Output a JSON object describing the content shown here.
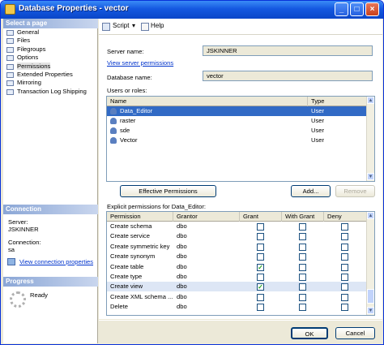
{
  "window": {
    "title": "Database Properties - vector"
  },
  "titlebar_buttons": {
    "minimize": "_",
    "maximize": "□",
    "close": "×"
  },
  "left": {
    "select_page_header": "Select a page",
    "pages": [
      {
        "label": "General"
      },
      {
        "label": "Files"
      },
      {
        "label": "Filegroups"
      },
      {
        "label": "Options"
      },
      {
        "label": "Permissions"
      },
      {
        "label": "Extended Properties"
      },
      {
        "label": "Mirroring"
      },
      {
        "label": "Transaction Log Shipping"
      }
    ],
    "connection_header": "Connection",
    "server_label": "Server:",
    "server_value": "JSKINNER",
    "connection_label": "Connection:",
    "connection_value": "sa",
    "view_connection_link": "View connection properties",
    "progress_header": "Progress",
    "progress_status": "Ready"
  },
  "toolbar": {
    "script_label": "Script",
    "help_label": "Help"
  },
  "form": {
    "server_name_label": "Server name:",
    "server_name_value": "JSKINNER",
    "view_server_permissions_link": "View server permissions",
    "database_name_label": "Database name:",
    "database_name_value": "vector",
    "users_roles_label": "Users or roles:"
  },
  "users_grid": {
    "columns": [
      "Name",
      "Type"
    ],
    "rows": [
      {
        "name": "Data_Editor",
        "type": "User"
      },
      {
        "name": "raster",
        "type": "User"
      },
      {
        "name": "sde",
        "type": "User"
      },
      {
        "name": "Vector",
        "type": "User"
      }
    ]
  },
  "buttons": {
    "effective_permissions": "Effective Permissions",
    "add": "Add...",
    "remove": "Remove",
    "ok": "OK",
    "cancel": "Cancel"
  },
  "permissions": {
    "label": "Explicit permissions for Data_Editor:",
    "columns": [
      "Permission",
      "Grantor",
      "Grant",
      "With Grant",
      "Deny"
    ],
    "rows": [
      {
        "permission": "Create schema",
        "grantor": "dbo",
        "grant": false,
        "with_grant": false,
        "deny": false
      },
      {
        "permission": "Create service",
        "grantor": "dbo",
        "grant": false,
        "with_grant": false,
        "deny": false
      },
      {
        "permission": "Create symmetric key",
        "grantor": "dbo",
        "grant": false,
        "with_grant": false,
        "deny": false
      },
      {
        "permission": "Create synonym",
        "grantor": "dbo",
        "grant": false,
        "with_grant": false,
        "deny": false
      },
      {
        "permission": "Create table",
        "grantor": "dbo",
        "grant": true,
        "with_grant": false,
        "deny": false
      },
      {
        "permission": "Create type",
        "grantor": "dbo",
        "grant": false,
        "with_grant": false,
        "deny": false
      },
      {
        "permission": "Create view",
        "grantor": "dbo",
        "grant": true,
        "with_grant": false,
        "deny": false
      },
      {
        "permission": "Create XML schema ...",
        "grantor": "dbo",
        "grant": false,
        "with_grant": false,
        "deny": false
      },
      {
        "permission": "Delete",
        "grantor": "dbo",
        "grant": false,
        "with_grant": false,
        "deny": false
      }
    ]
  },
  "colors": {
    "title_blue": "#1458e0",
    "selection": "#316ac5",
    "check_green": "#21a121",
    "link": "#0033cc"
  }
}
